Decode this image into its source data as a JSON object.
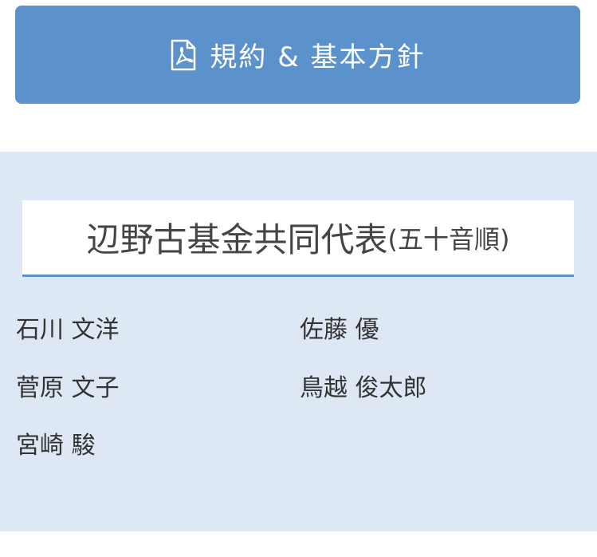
{
  "pdf_button": {
    "label": "規約 & 基本方針",
    "icon": "pdf-file-icon"
  },
  "representatives": {
    "title": "辺野古基金共同代表",
    "subtitle": "(五十音順)",
    "names": [
      "石川 文洋",
      "佐藤 優",
      "菅原 文子",
      "鳥越 俊太郎",
      "宮崎 駿"
    ]
  },
  "colors": {
    "button_bg": "#5b92cc",
    "panel_bg": "#dde8f4",
    "heading_underline": "#5b92cc"
  }
}
